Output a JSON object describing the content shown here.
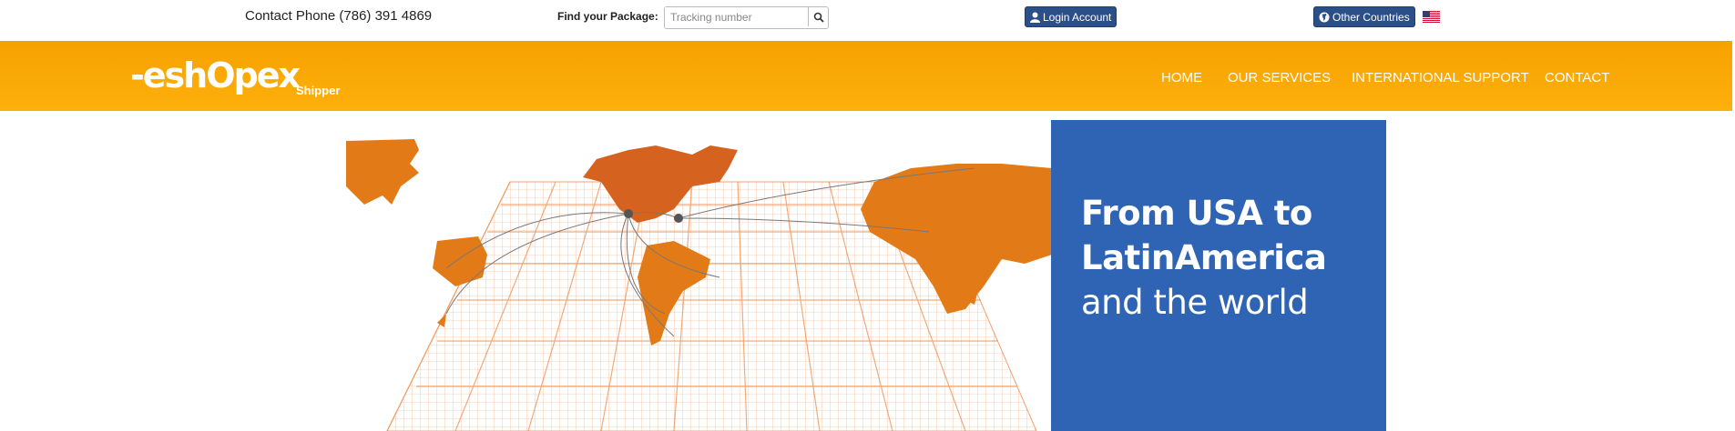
{
  "topbar": {
    "contact": "Contact Phone (786) 391 4869",
    "find_label": "Find your Package:",
    "tracking_placeholder": "Tracking number",
    "login": "Login Account",
    "other_countries": "Other Countries"
  },
  "brand": {
    "logo": "-eshOpex",
    "sub": "Shipper"
  },
  "nav": [
    "HOME",
    "OUR SERVICES",
    "INTERNATIONAL SUPPORT",
    "CONTACT"
  ],
  "hero": {
    "line1": "From USA to",
    "line2": "LatinAmerica",
    "line3": "and the world"
  },
  "colors": {
    "navbar": "#fbaa07",
    "promo": "#2f63b3",
    "buttons": "#2b4f88",
    "map": "#e27b17"
  }
}
